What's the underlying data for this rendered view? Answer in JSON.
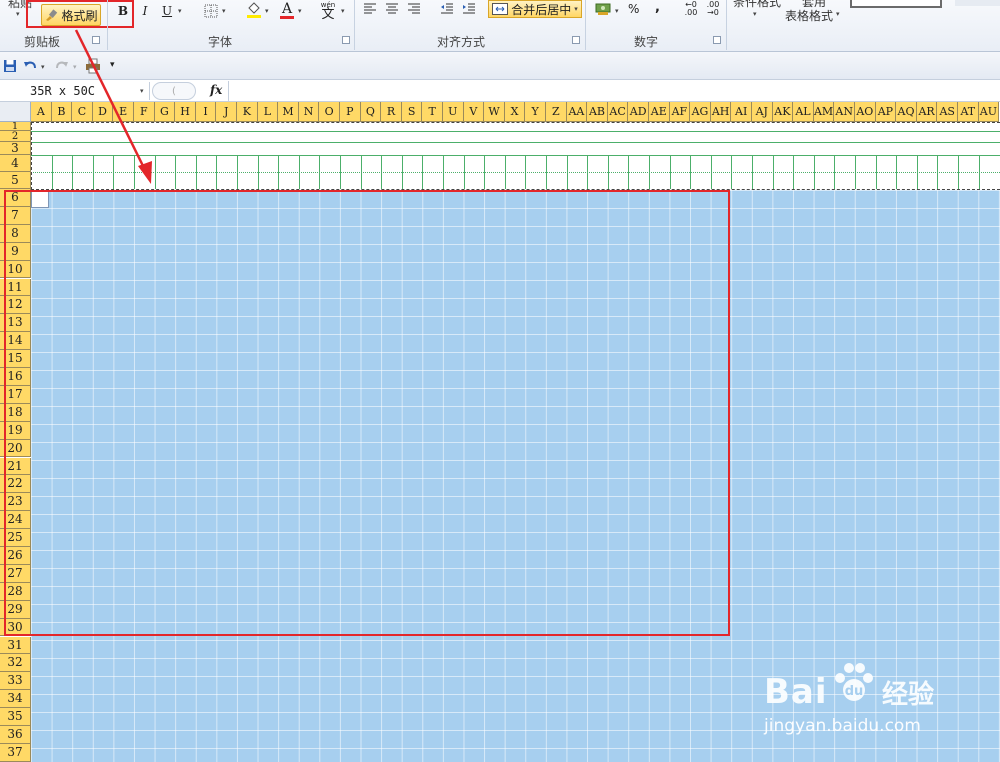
{
  "ribbon": {
    "paste_label_partial": "粘贴",
    "format_painter": "格式刷",
    "bold": "B",
    "italic": "I",
    "underline": "U",
    "font_color_letter": "A",
    "wen_label": "wén",
    "wen_char": "文",
    "merge_center": "合并后居中",
    "percent": "%",
    "comma": ",",
    "inc_decimal": ".00",
    "dec_decimal": ".00",
    "cond_format_partial": "条件格式",
    "table_format_top": "套用",
    "table_format": "表格格式",
    "group_clipboard": "剪贴板",
    "group_font": "字体",
    "group_align": "对齐方式",
    "group_number": "数字"
  },
  "formula_bar": {
    "name_box": "35R x 50C",
    "fx": "fx"
  },
  "grid": {
    "columns": [
      "A",
      "B",
      "C",
      "D",
      "E",
      "F",
      "G",
      "H",
      "I",
      "J",
      "K",
      "L",
      "M",
      "N",
      "O",
      "P",
      "Q",
      "R",
      "S",
      "T",
      "U",
      "V",
      "W",
      "X",
      "Y",
      "Z",
      "AA",
      "AB",
      "AC",
      "AD",
      "AE",
      "AF",
      "AG",
      "AH",
      "AI",
      "AJ",
      "AK",
      "AL",
      "AM",
      "AN",
      "AO",
      "AP",
      "AQ",
      "AR",
      "AS",
      "AT",
      "AU"
    ],
    "rows": [
      "1",
      "2",
      "3",
      "4",
      "5",
      "6",
      "7",
      "8",
      "9",
      "10",
      "11",
      "12",
      "13",
      "14",
      "15",
      "16",
      "17",
      "18",
      "19",
      "20",
      "21",
      "22",
      "23",
      "24",
      "25",
      "26",
      "27",
      "28",
      "29",
      "30",
      "31",
      "32",
      "33",
      "34",
      "35",
      "36",
      "37"
    ]
  },
  "watermark": {
    "brand": "Bai",
    "brand_suffix": "经验",
    "url": "jingyan.baidu.com"
  },
  "colors": {
    "header_yellow": "#ffd966",
    "selection_blue": "#a7cfef",
    "annotation_red": "#e3262a",
    "button_gold": "#ffd664",
    "gridline_green": "#4caf6a"
  }
}
